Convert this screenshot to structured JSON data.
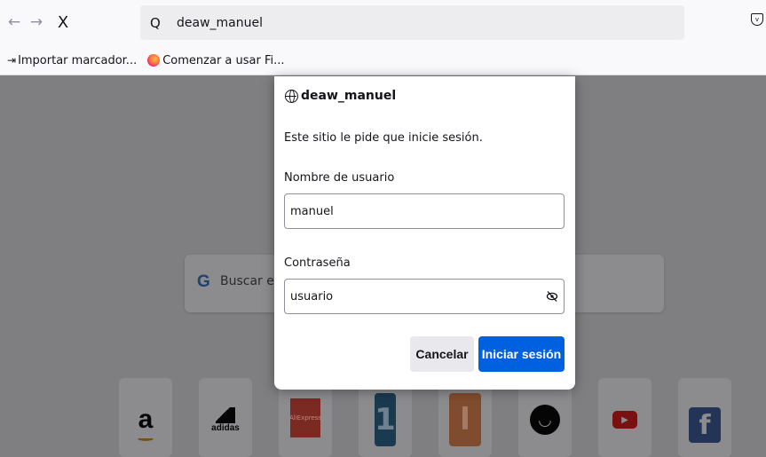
{
  "toolbar": {
    "back_icon": "←",
    "forward_icon": "→",
    "stop_icon": "X",
    "search_icon": "Q",
    "url": "deaw_manuel"
  },
  "bookmarks": [
    {
      "label": "Importar marcador...",
      "icon": "import-icon"
    },
    {
      "label": "Comenzar a usar Fi...",
      "icon": "firefox-icon"
    }
  ],
  "page": {
    "search_placeholder": "Buscar en",
    "google_letter": "G",
    "tiles": [
      {
        "name": "amazon",
        "text": "a"
      },
      {
        "name": "adidas",
        "text": "adidas"
      },
      {
        "name": "aliexpress",
        "text": "AliExpress"
      },
      {
        "name": "one",
        "text": "1"
      },
      {
        "name": "orange",
        "text": "l"
      },
      {
        "name": "github",
        "text": ""
      },
      {
        "name": "youtube",
        "text": "▶"
      },
      {
        "name": "facebook",
        "text": "f"
      }
    ]
  },
  "dialog": {
    "title": "deaw_manuel",
    "message": "Este sitio le pide que inicie sesión.",
    "username_label": "Nombre de usuario",
    "username_value": "manuel",
    "password_label": "Contraseña",
    "password_value": "usuario",
    "cancel_label": "Cancelar",
    "login_label": "Iniciar sesión"
  },
  "colors": {
    "primary_button": "#0061e0",
    "overlay": "#7f7f82"
  }
}
